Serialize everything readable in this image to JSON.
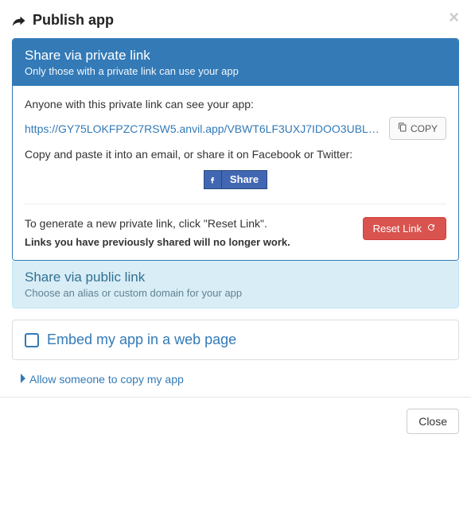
{
  "header": {
    "title": "Publish app"
  },
  "privatePanel": {
    "title": "Share via private link",
    "subtitle": "Only those with a private link can use your app",
    "intro": "Anyone with this private link can see your app:",
    "url": "https://GY75LOKFPZC7RSW5.anvil.app/VBWT6LF3UXJ7IDOO3UBL…",
    "copyLabel": "COPY",
    "copyPaste": "Copy and paste it into an email, or share it on Facebook or Twitter:",
    "fbShare": "Share",
    "resetIntro": "To generate a new private link, click \"Reset Link\".",
    "resetWarning": "Links you have previously shared will no longer work.",
    "resetButton": "Reset Link"
  },
  "publicPanel": {
    "title": "Share via public link",
    "subtitle": "Choose an alias or custom domain for your app"
  },
  "embed": {
    "title": "Embed my app in a web page"
  },
  "allowCopy": {
    "label": "Allow someone to copy my app"
  },
  "footer": {
    "close": "Close"
  }
}
